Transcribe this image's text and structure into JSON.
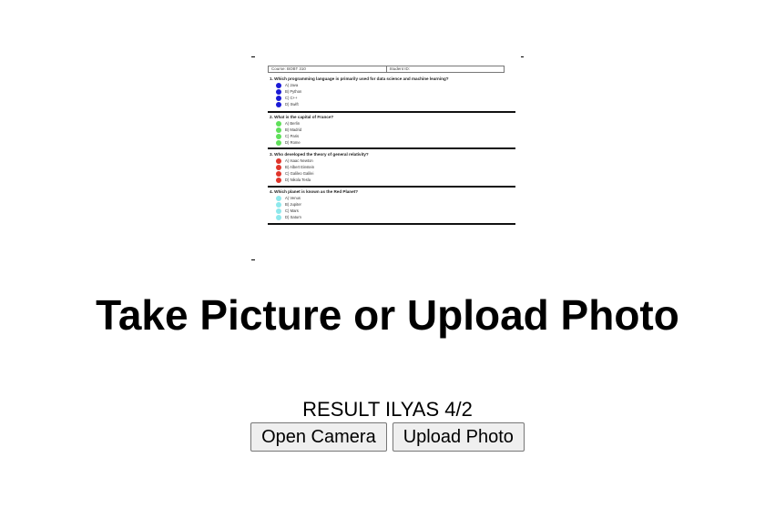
{
  "scan": {
    "header": {
      "course": "Course: BOBT 310",
      "student": "Student ID:"
    },
    "questions": [
      {
        "text": "1. Which programming language is primarily used for data science and machine learning?",
        "color": "#1a1ad6",
        "options": [
          "A) Java",
          "B) Python",
          "C) C++",
          "D) Swift"
        ]
      },
      {
        "text": "2. What is the capital of France?",
        "color": "#5fe05a",
        "options": [
          "A) Berlin",
          "B) Madrid",
          "C) Paris",
          "D) Rome"
        ]
      },
      {
        "text": "3. Who developed the theory of general relativity?",
        "color": "#e0352b",
        "options": [
          "A) Isaac Newton",
          "B) Albert Einstein",
          "C) Galileo Galilei",
          "D) Nikola Tesla"
        ]
      },
      {
        "text": "4. Which planet is known as the Red Planet?",
        "color": "#8ee8ec",
        "options": [
          "A) Venus",
          "B) Jupiter",
          "C) Mars",
          "D) Saturn"
        ]
      }
    ]
  },
  "title": "Take Picture or Upload Photo",
  "result": "RESULT ILYAS 4/2",
  "buttons": {
    "open_camera": "Open Camera",
    "upload_photo": "Upload Photo"
  }
}
